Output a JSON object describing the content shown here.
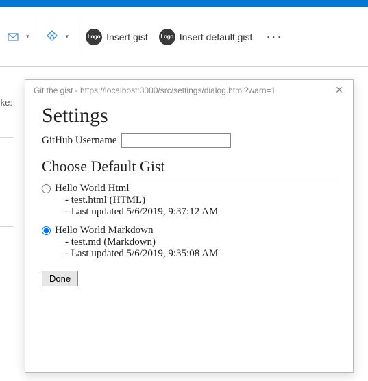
{
  "toolbar": {
    "insert_gist_label": "Insert gist",
    "insert_default_gist_label": "Insert default gist",
    "logo_text": "Logo"
  },
  "left": {
    "truncated_label": "ke:"
  },
  "dialog": {
    "title": "Git the gist - https://localhost:3000/src/settings/dialog.html?warn=1",
    "heading": "Settings",
    "username_label": "GitHub Username",
    "username_value": "",
    "choose_heading": "Choose Default Gist",
    "gists": [
      {
        "title": "Hello World Html",
        "file_line": "- test.html (HTML)",
        "updated_line": "- Last updated 5/6/2019, 9:37:12 AM",
        "selected": false
      },
      {
        "title": "Hello World Markdown",
        "file_line": "- test.md (Markdown)",
        "updated_line": "- Last updated 5/6/2019, 9:35:08 AM",
        "selected": true
      }
    ],
    "done_label": "Done"
  }
}
